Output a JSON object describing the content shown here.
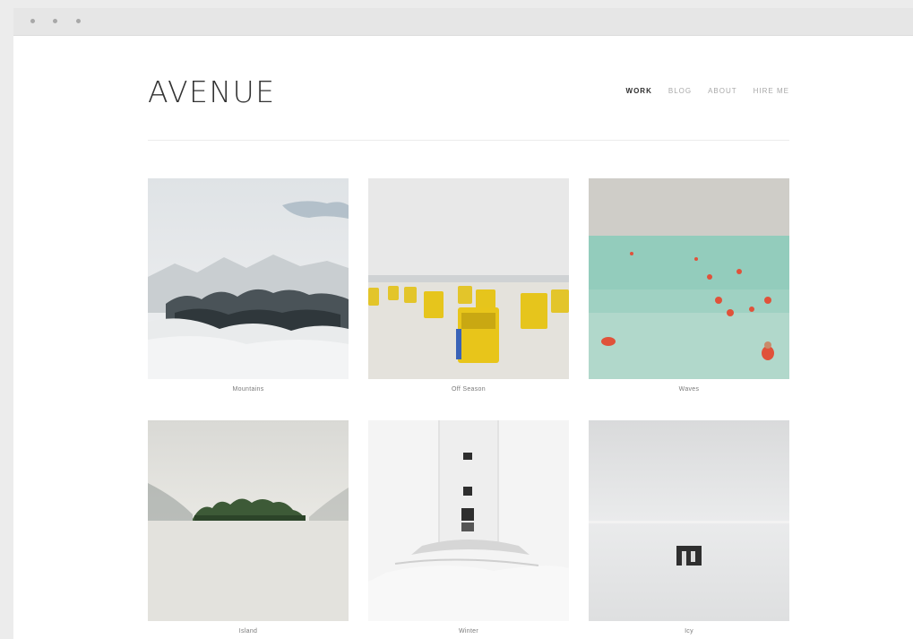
{
  "window": {
    "controls": [
      "close",
      "minimize",
      "zoom"
    ]
  },
  "header": {
    "logo": "AVENUE",
    "nav": [
      {
        "label": "WORK",
        "active": true
      },
      {
        "label": "BLOG",
        "active": false
      },
      {
        "label": "ABOUT",
        "active": false
      },
      {
        "label": "HIRE ME",
        "active": false
      }
    ]
  },
  "gallery": [
    {
      "caption": "Mountains",
      "image": "snowy-mountains"
    },
    {
      "caption": "Off Season",
      "image": "yellow-beach-chairs"
    },
    {
      "caption": "Waves",
      "image": "swimmers-in-sea"
    },
    {
      "caption": "Island",
      "image": "island-in-lake"
    },
    {
      "caption": "Winter",
      "image": "white-tower"
    },
    {
      "caption": "Icy",
      "image": "ice-hut"
    }
  ]
}
